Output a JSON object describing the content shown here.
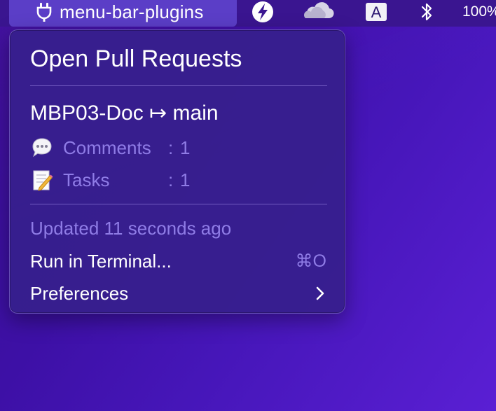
{
  "menubar": {
    "plugin_label": "menu-bar-plugins",
    "plugin_icon": "plug-icon",
    "icons": [
      "bolt-icon",
      "cloud-icon",
      "input-source-icon",
      "bluetooth-icon"
    ],
    "input_source_label": "A",
    "battery_text": "100%",
    "bar_color": "#3a1590",
    "chip_color": "#5b3ec7"
  },
  "menu": {
    "title": "Open Pull Requests",
    "pull_request": {
      "title": "MBP03-Doc ↦ main",
      "stats": [
        {
          "icon": "speech-bubble-icon",
          "label": "Comments",
          "separator": ":",
          "value": "1"
        },
        {
          "icon": "memo-icon",
          "label": "Tasks",
          "separator": ":",
          "value": "1"
        }
      ]
    },
    "updated_text": "Updated 11 seconds ago",
    "items": [
      {
        "label": "Run in Terminal...",
        "shortcut": "⌘O"
      },
      {
        "label": "Preferences",
        "submenu_icon": "chevron-right-icon"
      }
    ],
    "dim_text_color": "#8f7ce6"
  }
}
